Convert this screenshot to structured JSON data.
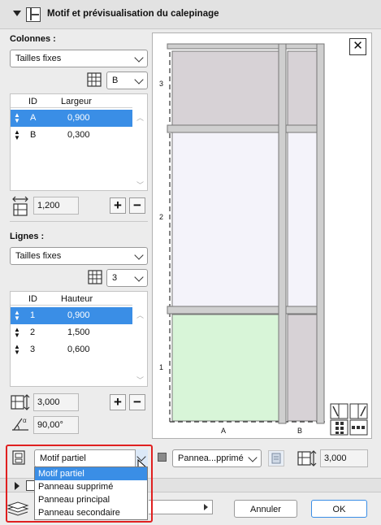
{
  "panel": {
    "title": "Motif et prévisualisation du calepinage"
  },
  "columns": {
    "label": "Colonnes :",
    "mode_value": "Tailles fixes",
    "ref_value": "B",
    "headers": {
      "id": "ID",
      "size": "Largeur"
    },
    "rows": [
      {
        "id": "A",
        "value": "0,900",
        "selected": true
      },
      {
        "id": "B",
        "value": "0,300",
        "selected": false
      }
    ],
    "total_value": "1,200"
  },
  "lines": {
    "label": "Lignes :",
    "mode_value": "Tailles fixes",
    "count_value": "3",
    "headers": {
      "id": "ID",
      "size": "Hauteur"
    },
    "rows": [
      {
        "id": "1",
        "value": "0,900",
        "selected": true
      },
      {
        "id": "2",
        "value": "1,500",
        "selected": false
      },
      {
        "id": "3",
        "value": "0,600",
        "selected": false
      }
    ],
    "total_value": "3,000",
    "angle_value": "90,00°"
  },
  "buttons": {
    "plus": "+",
    "minus": "−",
    "cancel": "Annuler",
    "ok": "OK"
  },
  "preview": {
    "close": "✕",
    "row_labels": [
      "3",
      "2",
      "1"
    ],
    "col_labels": [
      "A",
      "B"
    ]
  },
  "bottom": {
    "motif_value": "Motif partiel",
    "motif_options": [
      "Motif partiel",
      "Panneau supprimé",
      "Panneau principal",
      "Panneau secondaire"
    ],
    "panel_value": "Pannea...pprimé",
    "height_value": "3,000"
  },
  "colors": {
    "accent": "#3a8ee6",
    "highlight": "#e02020",
    "panel_fill": "#d7d2d6",
    "panel_green": "#d8f5d8",
    "panel_light": "#f4f3fa"
  }
}
